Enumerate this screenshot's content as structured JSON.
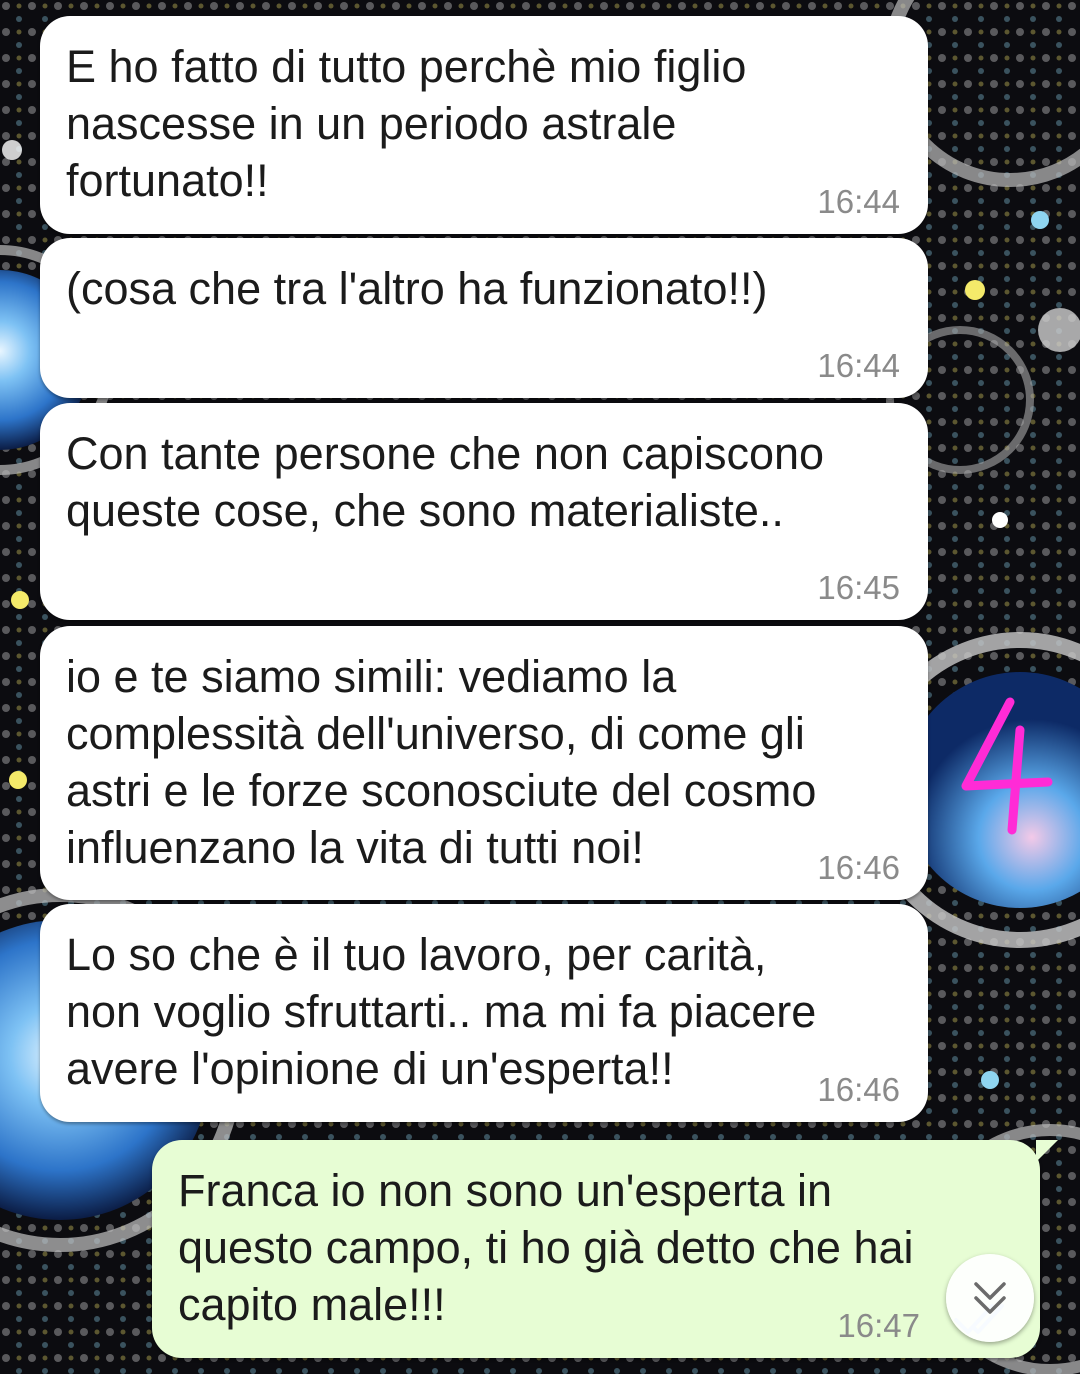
{
  "messages": [
    {
      "direction": "in",
      "text": "E ho fatto di tutto perchè mio figlio\nnascesse in un periodo astrale\nfortunato!!",
      "time": "16:44"
    },
    {
      "direction": "in",
      "text": "(cosa che tra l'altro ha funzionato!!)",
      "time": "16:44"
    },
    {
      "direction": "in",
      "text": "Con tante persone che non capiscono\nqueste cose, che sono materialiste..",
      "time": "16:45"
    },
    {
      "direction": "in",
      "text": "io e te siamo simili: vediamo la\ncomplessità dell'universo, di come gli\nastri e le forze sconosciute del cosmo\ninfluenzano la vita di tutti noi!",
      "time": "16:46"
    },
    {
      "direction": "in",
      "text": "Lo so che è il tuo lavoro, per carità,\nnon voglio sfruttarti.. ma mi fa piacere\navere l'opinione di un'esperta!!",
      "time": "16:46"
    },
    {
      "direction": "out",
      "text": "Franca io non sono un'esperta in\nquesto campo, ti ho già detto che hai\ncapito male!!!",
      "time": "16:47"
    }
  ],
  "annotation": {
    "label": "4",
    "color": "#ff2bd6"
  },
  "colors": {
    "incoming_bubble": "#ffffff",
    "outgoing_bubble": "#e7fdd4",
    "timestamp": "#8a8a8a",
    "read_ticks": "#9ec9f5"
  },
  "icons": {
    "scroll_down": "double-chevron-down-icon",
    "read_receipt": "double-check-icon"
  }
}
